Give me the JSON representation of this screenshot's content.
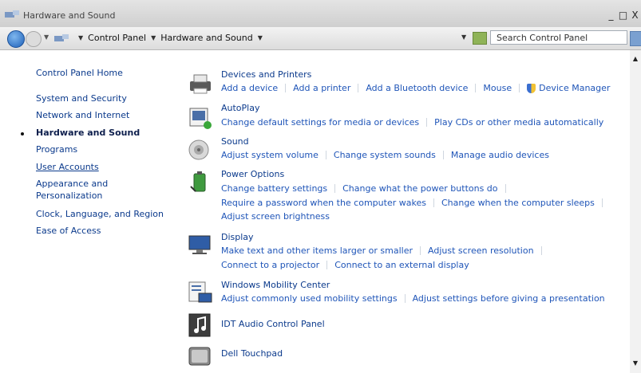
{
  "window": {
    "title": "Hardware and Sound",
    "minimize": "_",
    "maximize": "□",
    "close": "X"
  },
  "addressbar": {
    "crumbs": [
      "Control Panel",
      "Hardware and Sound"
    ],
    "search_placeholder": "Search Control Panel"
  },
  "leftnav": {
    "items": [
      "Control Panel Home",
      "System and Security",
      "Network and Internet",
      "Hardware and Sound",
      "Programs",
      "User Accounts",
      "Appearance and",
      "Personalization",
      "Clock, Language, and Region",
      "Ease of Access"
    ]
  },
  "categories": {
    "devices": {
      "title": "Devices and Printers",
      "links": [
        "Add a device",
        "Add a printer",
        "Add a Bluetooth device",
        "Mouse",
        "Device Manager"
      ]
    },
    "autoplay": {
      "title": "AutoPlay",
      "links": [
        "Change default settings for media or devices",
        "Play CDs or other media automatically"
      ]
    },
    "sound": {
      "title": "Sound",
      "links": [
        "Adjust system volume",
        "Change system sounds",
        "Manage audio devices"
      ]
    },
    "power": {
      "title": "Power Options",
      "links": [
        "Change battery settings",
        "Change what the power buttons do",
        "Require a password when the computer wakes",
        "Change when the computer sleeps",
        "Adjust screen brightness"
      ]
    },
    "display": {
      "title": "Display",
      "links": [
        "Make text and other items larger or smaller",
        "Adjust screen resolution",
        "Connect to a projector",
        "Connect to an external display"
      ]
    },
    "mobility": {
      "title": "Windows Mobility Center",
      "links": [
        "Adjust commonly used mobility settings",
        "Adjust settings before giving a presentation"
      ]
    },
    "idt": {
      "title": "IDT Audio Control Panel"
    },
    "touchpad": {
      "title": "Dell Touchpad"
    }
  },
  "icons": {
    "devices": "printer-icon",
    "autoplay": "autoplay-icon",
    "sound": "speaker-icon",
    "power": "battery-icon",
    "display": "monitor-icon",
    "mobility": "mobility-icon",
    "idt": "audio-note-icon",
    "touchpad": "touchpad-icon",
    "device_manager": "shield-icon"
  },
  "colors": {
    "link": "#1f55b8",
    "title_link": "#0b3a8c",
    "current_nav": "#0e1f4d"
  }
}
